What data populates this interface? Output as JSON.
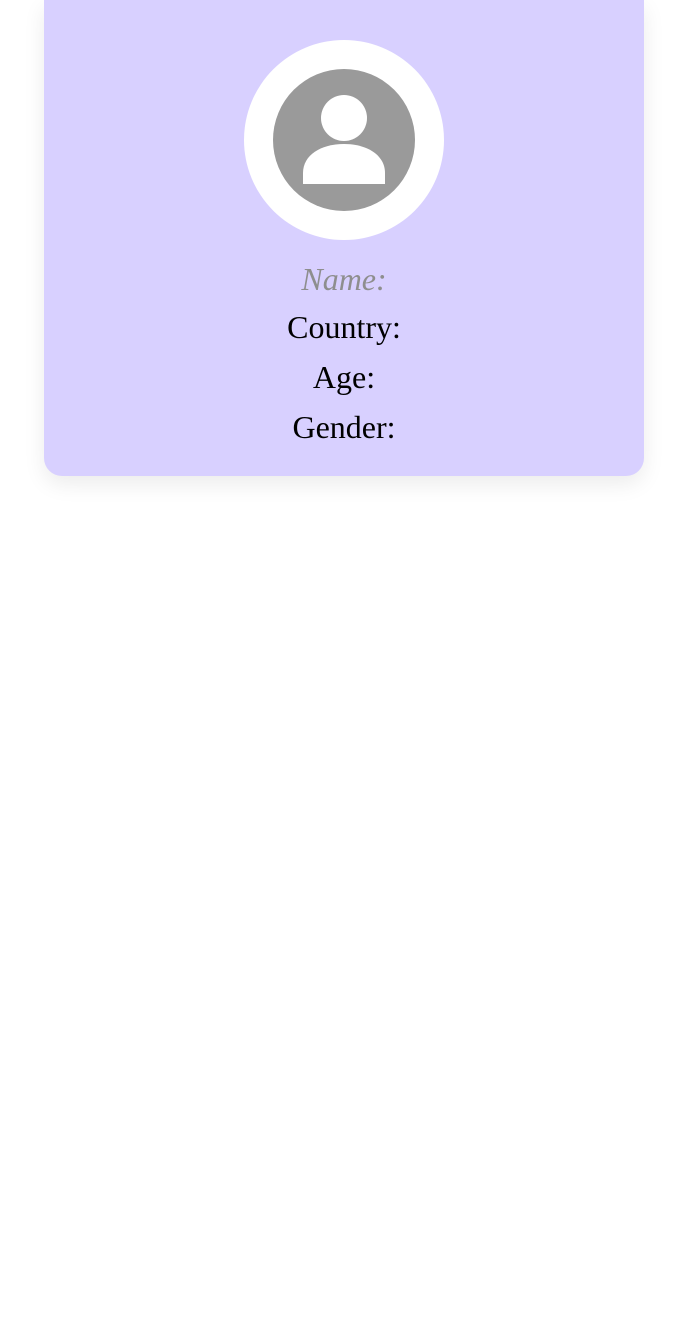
{
  "profile": {
    "avatar_icon": "user-avatar-icon",
    "name_label": "Name:",
    "country_label": "Country:",
    "age_label": "Age:",
    "gender_label": "Gender:"
  },
  "colors": {
    "card_background": "#d8d0ff",
    "avatar_ring": "#ffffff",
    "avatar_fill": "#9a9a9a",
    "name_text": "#8e8e8e",
    "body_text": "#000000"
  }
}
